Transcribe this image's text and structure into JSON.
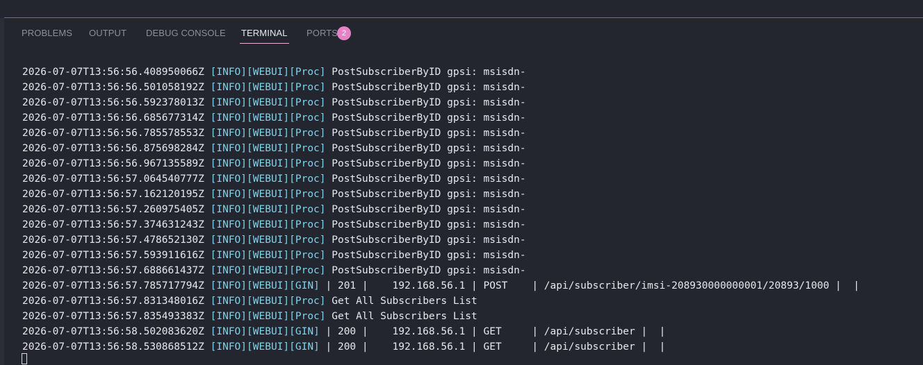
{
  "panel": {
    "tabs": [
      {
        "label": "PROBLEMS"
      },
      {
        "label": "OUTPUT"
      },
      {
        "label": "DEBUG CONSOLE"
      },
      {
        "label": "TERMINAL"
      },
      {
        "label": "PORTS",
        "badge": "2"
      }
    ],
    "active_tab": "TERMINAL"
  },
  "colors": {
    "background": "#23262e",
    "accent_border": "#7a5fc0",
    "active_underline": "#e7b3d9",
    "badge": "#e882c6",
    "log_tag": "#7fd3ec",
    "text": "#e6e8ee"
  },
  "terminal": {
    "lines": [
      {
        "ts": "2026-07-07T13:56:56.408950066Z",
        "tag": "[INFO][WEBUI][Proc]",
        "msg": " PostSubscriberByID gpsi: msisdn-"
      },
      {
        "ts": "2026-07-07T13:56:56.501058192Z",
        "tag": "[INFO][WEBUI][Proc]",
        "msg": " PostSubscriberByID gpsi: msisdn-"
      },
      {
        "ts": "2026-07-07T13:56:56.592378013Z",
        "tag": "[INFO][WEBUI][Proc]",
        "msg": " PostSubscriberByID gpsi: msisdn-"
      },
      {
        "ts": "2026-07-07T13:56:56.685677314Z",
        "tag": "[INFO][WEBUI][Proc]",
        "msg": " PostSubscriberByID gpsi: msisdn-"
      },
      {
        "ts": "2026-07-07T13:56:56.785578553Z",
        "tag": "[INFO][WEBUI][Proc]",
        "msg": " PostSubscriberByID gpsi: msisdn-"
      },
      {
        "ts": "2026-07-07T13:56:56.875698284Z",
        "tag": "[INFO][WEBUI][Proc]",
        "msg": " PostSubscriberByID gpsi: msisdn-"
      },
      {
        "ts": "2026-07-07T13:56:56.967135589Z",
        "tag": "[INFO][WEBUI][Proc]",
        "msg": " PostSubscriberByID gpsi: msisdn-"
      },
      {
        "ts": "2026-07-07T13:56:57.064540777Z",
        "tag": "[INFO][WEBUI][Proc]",
        "msg": " PostSubscriberByID gpsi: msisdn-"
      },
      {
        "ts": "2026-07-07T13:56:57.162120195Z",
        "tag": "[INFO][WEBUI][Proc]",
        "msg": " PostSubscriberByID gpsi: msisdn-"
      },
      {
        "ts": "2026-07-07T13:56:57.260975405Z",
        "tag": "[INFO][WEBUI][Proc]",
        "msg": " PostSubscriberByID gpsi: msisdn-"
      },
      {
        "ts": "2026-07-07T13:56:57.374631243Z",
        "tag": "[INFO][WEBUI][Proc]",
        "msg": " PostSubscriberByID gpsi: msisdn-"
      },
      {
        "ts": "2026-07-07T13:56:57.478652130Z",
        "tag": "[INFO][WEBUI][Proc]",
        "msg": " PostSubscriberByID gpsi: msisdn-"
      },
      {
        "ts": "2026-07-07T13:56:57.593911616Z",
        "tag": "[INFO][WEBUI][Proc]",
        "msg": " PostSubscriberByID gpsi: msisdn-"
      },
      {
        "ts": "2026-07-07T13:56:57.688661437Z",
        "tag": "[INFO][WEBUI][Proc]",
        "msg": " PostSubscriberByID gpsi: msisdn-"
      },
      {
        "ts": "2026-07-07T13:56:57.785717794Z",
        "tag": "[INFO][WEBUI][GIN]",
        "msg": " | 201 |    192.168.56.1 | POST    | /api/subscriber/imsi-208930000000001/20893/1000 |  |"
      },
      {
        "ts": "2026-07-07T13:56:57.831348016Z",
        "tag": "[INFO][WEBUI][Proc]",
        "msg": " Get All Subscribers List"
      },
      {
        "ts": "2026-07-07T13:56:57.835493383Z",
        "tag": "[INFO][WEBUI][Proc]",
        "msg": " Get All Subscribers List"
      },
      {
        "ts": "2026-07-07T13:56:58.502083620Z",
        "tag": "[INFO][WEBUI][GIN]",
        "msg": " | 200 |    192.168.56.1 | GET     | /api/subscriber |  |"
      },
      {
        "ts": "2026-07-07T13:56:58.530868512Z",
        "tag": "[INFO][WEBUI][GIN]",
        "msg": " | 200 |    192.168.56.1 | GET     | /api/subscriber |  |"
      }
    ]
  }
}
